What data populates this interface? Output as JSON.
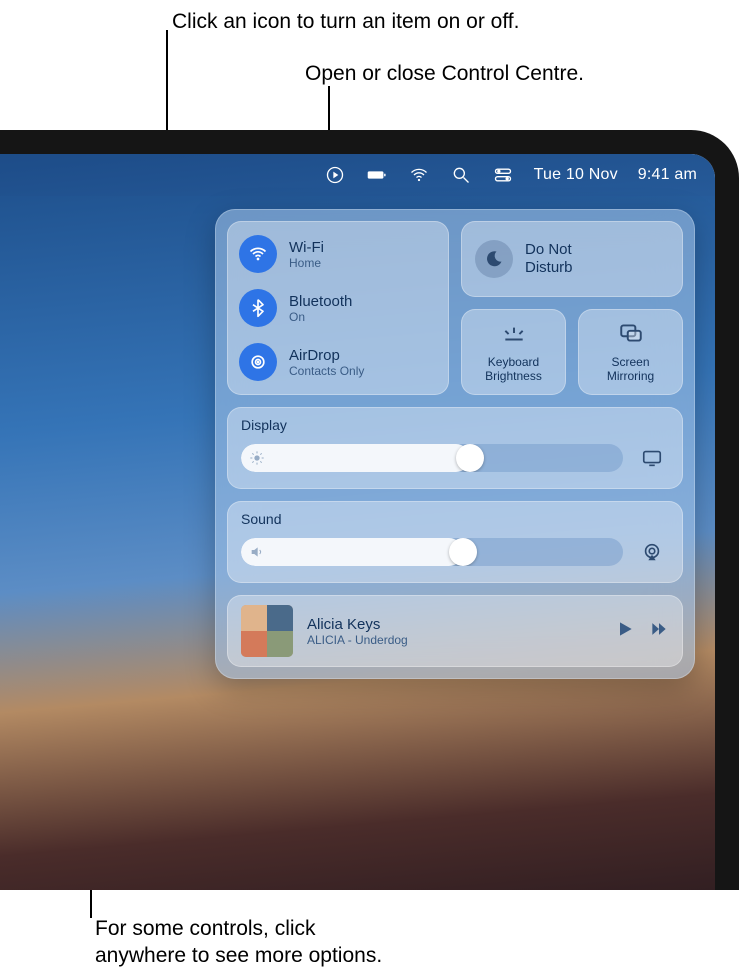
{
  "callouts": {
    "toggle": "Click an icon to turn an item on or off.",
    "open_close": "Open or close Control Centre.",
    "more_options_l1": "For some controls, click",
    "more_options_l2": "anywhere to see more options."
  },
  "menubar": {
    "date": "Tue 10 Nov",
    "time": "9:41 am"
  },
  "connectivity": {
    "wifi": {
      "title": "Wi-Fi",
      "subtitle": "Home"
    },
    "bluetooth": {
      "title": "Bluetooth",
      "subtitle": "On"
    },
    "airdrop": {
      "title": "AirDrop",
      "subtitle": "Contacts Only"
    }
  },
  "dnd": {
    "title_l1": "Do Not",
    "title_l2": "Disturb"
  },
  "small": {
    "keyboard_l1": "Keyboard",
    "keyboard_l2": "Brightness",
    "mirror_l1": "Screen",
    "mirror_l2": "Mirroring"
  },
  "display": {
    "label": "Display",
    "percent": 60
  },
  "sound": {
    "label": "Sound",
    "percent": 58
  },
  "nowplaying": {
    "artist": "Alicia Keys",
    "track": "ALICIA - Underdog"
  }
}
